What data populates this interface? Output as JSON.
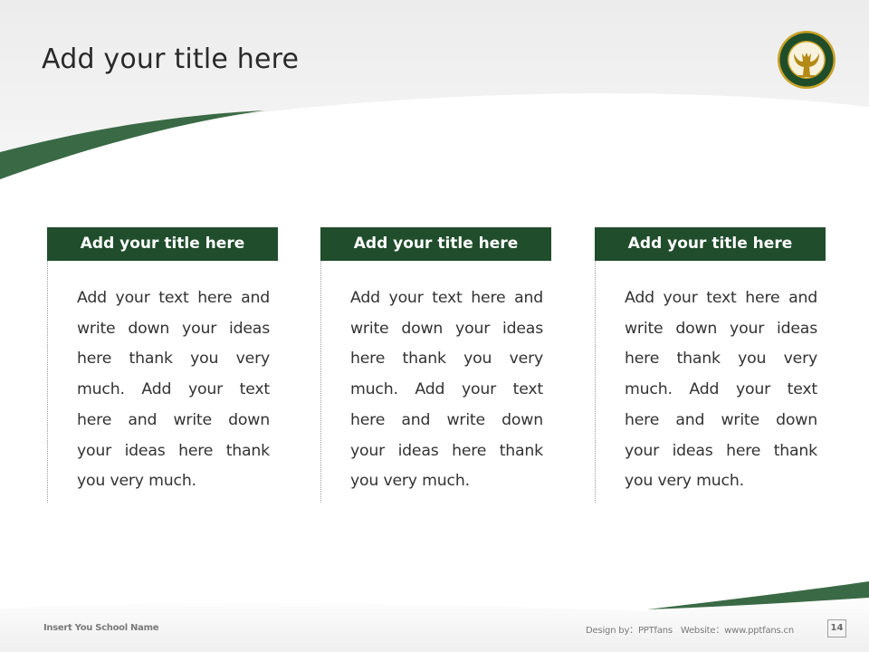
{
  "slide": {
    "title": "Add your title here",
    "logo_icon": "university-seal-icon",
    "colors": {
      "brand_green": "#204d2c",
      "swoosh_green": "#3a6a45",
      "seal_gold": "#c9a227",
      "text_dark": "#333333",
      "footer_gray": "#7a7a7a"
    }
  },
  "cards": [
    {
      "title": "Add your title here",
      "body": "Add your text here and write down your ideas here thank you very much. Add your text here and write down your ideas here thank you very much."
    },
    {
      "title": "Add your title here",
      "body": "Add your text here and write down your ideas here thank you very much. Add your text here and write down your ideas here thank you very much."
    },
    {
      "title": "Add your title here",
      "body": "Add your text here and write down your ideas here thank you very much. Add your text here and write down your ideas here thank you very much."
    }
  ],
  "footer": {
    "school_name": "Insert You School Name",
    "design_credit": "Design by：PPTfans   Website：www.pptfans.cn",
    "page_number": "14"
  }
}
